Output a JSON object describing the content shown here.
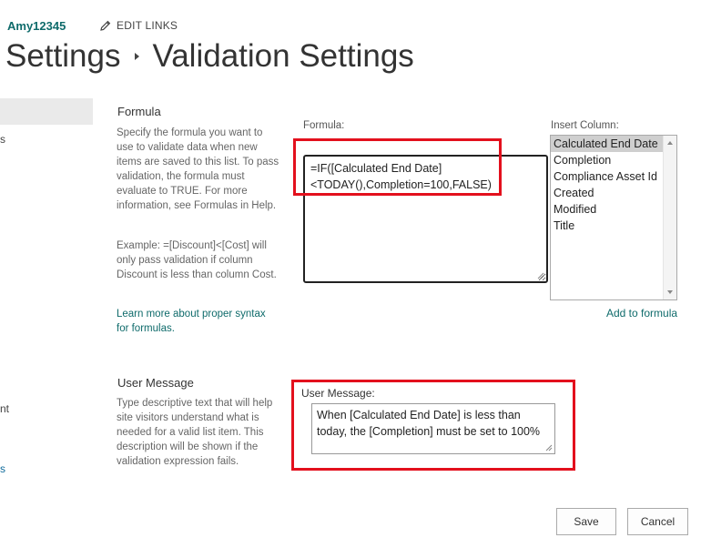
{
  "header": {
    "username": "Amy12345",
    "edit_links": "EDIT LINKS",
    "breadcrumb_parent": "Settings",
    "breadcrumb_current": "Validation Settings"
  },
  "nav": {
    "frag1": "s",
    "frag2": "nt",
    "frag3": "s"
  },
  "formula_section": {
    "title": "Formula",
    "description": "Specify the formula you want to use to validate data when new items are saved to this list. To pass validation, the formula must evaluate to TRUE. For more information, see Formulas in Help.",
    "example": "Example: =[Discount]<[Cost] will only pass validation if column Discount is less than column Cost.",
    "link": "Learn more about proper syntax for formulas.",
    "field_label": "Formula:",
    "field_value": "=IF([Calculated End Date]<TODAY(),Completion=100,FALSE)"
  },
  "insert_column": {
    "label": "Insert Column:",
    "options": [
      "Calculated End Date",
      "Completion",
      "Compliance Asset Id",
      "Created",
      "Modified",
      "Title"
    ],
    "selected": "Calculated End Date",
    "add_link": "Add to formula"
  },
  "message_section": {
    "title": "User Message",
    "description": "Type descriptive text that will help site visitors understand what is needed for a valid list item. This description will be shown if the validation expression fails.",
    "field_label": "User Message:",
    "field_value": "When [Calculated End Date] is less than today, the [Completion]  must be set to 100%"
  },
  "buttons": {
    "save": "Save",
    "cancel": "Cancel"
  },
  "colors": {
    "accent_link": "#0f6b6b",
    "highlight": "#e3101d",
    "selected_option": "#cfcfcf"
  }
}
